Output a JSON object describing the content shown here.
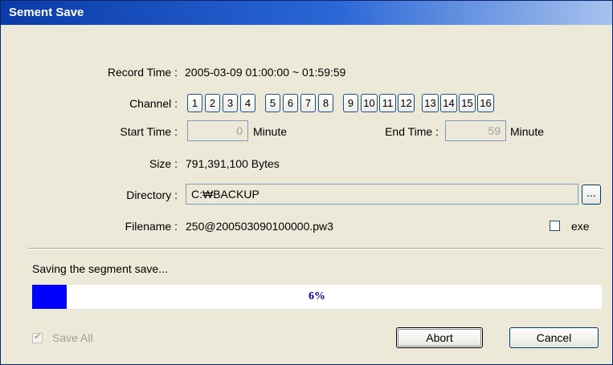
{
  "window": {
    "title": "Sement Save"
  },
  "record": {
    "label": "Record Time :",
    "value": "2005-03-09  01:00:00  ~  01:59:59"
  },
  "channel": {
    "label": "Channel :",
    "buttons": [
      "1",
      "2",
      "3",
      "4",
      "5",
      "6",
      "7",
      "8",
      "9",
      "10",
      "11",
      "12",
      "13",
      "14",
      "15",
      "16"
    ]
  },
  "start": {
    "label": "Start Time :",
    "value": "0",
    "unit": "Minute"
  },
  "end": {
    "label": "End Time :",
    "value": "59",
    "unit": "Minute"
  },
  "size": {
    "label": "Size :",
    "value": "791,391,100 Bytes"
  },
  "directory": {
    "label": "Directory :",
    "value": "C:₩BACKUP",
    "browse": "..."
  },
  "filename": {
    "label": "Filename :",
    "value": "250@200503090100000.pw3"
  },
  "exe": {
    "label": "exe",
    "checked": false
  },
  "status": {
    "text": "Saving the segment save..."
  },
  "progress": {
    "text": "6%",
    "value": 0.06,
    "color": "#0000ff"
  },
  "save_all": {
    "label": "Save All",
    "checked": true,
    "disabled": true
  },
  "buttons": {
    "abort": "Abort",
    "cancel": "Cancel"
  }
}
